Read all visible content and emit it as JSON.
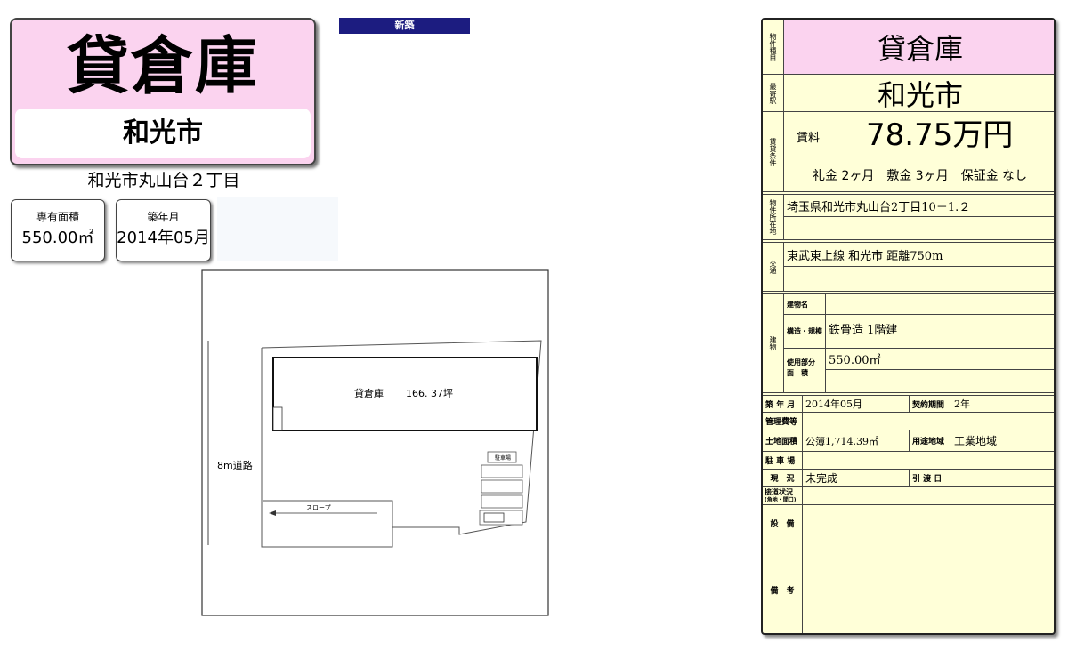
{
  "title": "貸倉庫",
  "city": "和光市",
  "address": "和光市丸山台２丁目",
  "banner": "新築",
  "summary": {
    "area_label": "専有面積",
    "area_value": "550.00㎡",
    "built_label": "築年月",
    "built_value": "2014年05月"
  },
  "floorplan": {
    "warehouse_label": "貸倉庫",
    "warehouse_area": "166. 37坪",
    "road_label": "8m道路",
    "slope_label": "スロープ",
    "parking_label": "駐車場"
  },
  "sheet": {
    "type_label": "物件種目",
    "type_value": "貸倉庫",
    "station_label": "最寄駅",
    "station_value": "和光市",
    "terms_label": "賃貸条件",
    "rent_label": "賃料",
    "rent_value": "78.75万円",
    "deposit_line": "礼金 2ヶ月　敷金 3ヶ月　保証金 なし",
    "location_label": "物件所在地",
    "location_value": "埼玉県和光市丸山台2丁目10－1.２",
    "transport_label": "交通",
    "transport_value": "東武東上線 和光市 距離750m",
    "building_label": "建物",
    "bname_label": "建物名",
    "bname_value": "",
    "structure_label": "構造・規模",
    "structure_value": "鉄骨造 1階建",
    "usearea_label_1": "使用部分",
    "usearea_label_2": "面　積",
    "usearea_value": "550.00㎡",
    "built_label": "築 年 月",
    "built_value": "2014年05月",
    "contract_label": "契約期間",
    "contract_value": "2年",
    "mgmt_label": "管理費等",
    "land_label": "土地面積",
    "land_value": "公簿1,714.39㎡",
    "zoning_label": "用途地域",
    "zoning_value": "工業地域",
    "parking_label": "駐 車 場",
    "status_label": "現　況",
    "status_value": "未完成",
    "handover_label": "引 渡 日",
    "road_label_1": "接道状況",
    "road_label_2": "(角地・間口)",
    "facility_label": "設　備",
    "remarks_label": "備　考"
  },
  "colors": {
    "pink": "#fbd3ef",
    "cream": "#ffffd8",
    "banner": "#1c1c80"
  }
}
